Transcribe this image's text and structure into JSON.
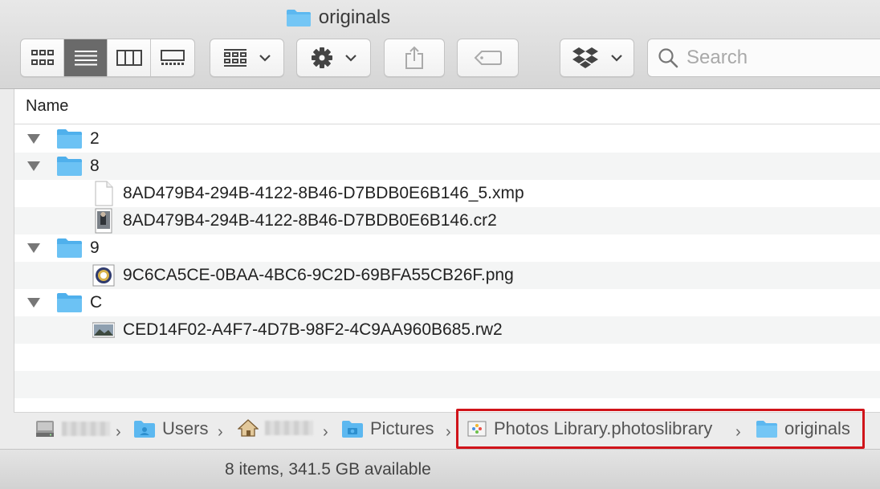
{
  "window": {
    "title": "originals"
  },
  "toolbar": {
    "view_modes": [
      {
        "name": "icon-view",
        "icon": "grid-icon"
      },
      {
        "name": "list-view",
        "icon": "list-icon",
        "active": true
      },
      {
        "name": "column-view",
        "icon": "columns-icon"
      },
      {
        "name": "gallery-view",
        "icon": "gallery-icon"
      }
    ],
    "group_icon": "group-by-icon",
    "action_icon": "gear-icon",
    "share_icon": "share-icon",
    "tag_icon": "tag-icon",
    "dropbox_icon": "dropbox-icon"
  },
  "search": {
    "placeholder": "Search",
    "value": ""
  },
  "list": {
    "column_header": "Name",
    "rows": [
      {
        "type": "folder",
        "name": "2",
        "expanded": true
      },
      {
        "type": "folder",
        "name": "8",
        "expanded": true
      },
      {
        "type": "file",
        "name": "8AD479B4-294B-4122-8B46-D7BDB0E6B146_5.xmp",
        "icon": "document-icon"
      },
      {
        "type": "file",
        "name": "8AD479B4-294B-4122-8B46-D7BDB0E6B146.cr2",
        "icon": "raw-photo-icon"
      },
      {
        "type": "folder",
        "name": "9",
        "expanded": true
      },
      {
        "type": "file",
        "name": "9C6CA5CE-0BAA-4BC6-9C2D-69BFA55CB26F.png",
        "icon": "png-image-icon"
      },
      {
        "type": "folder",
        "name": "C",
        "expanded": true
      },
      {
        "type": "file",
        "name": "CED14F02-A4F7-4D7B-98F2-4C9AA960B685.rw2",
        "icon": "landscape-photo-icon"
      }
    ]
  },
  "path_bar": {
    "items": [
      {
        "label": "",
        "icon": "hard-drive-icon",
        "redacted": true
      },
      {
        "label": "Users",
        "icon": "users-folder-icon"
      },
      {
        "label": "",
        "icon": "home-icon",
        "redacted": true
      },
      {
        "label": "Pictures",
        "icon": "pictures-folder-icon"
      },
      {
        "label": "Photos Library.photoslibrary",
        "icon": "photos-library-icon"
      },
      {
        "label": "originals",
        "icon": "folder-icon"
      }
    ],
    "highlight_color": "#d0141a"
  },
  "status": {
    "text": "8 items, 341.5 GB available"
  },
  "colors": {
    "folder_blue": "#5cb8f0",
    "active_view": "#6a6a6a"
  }
}
